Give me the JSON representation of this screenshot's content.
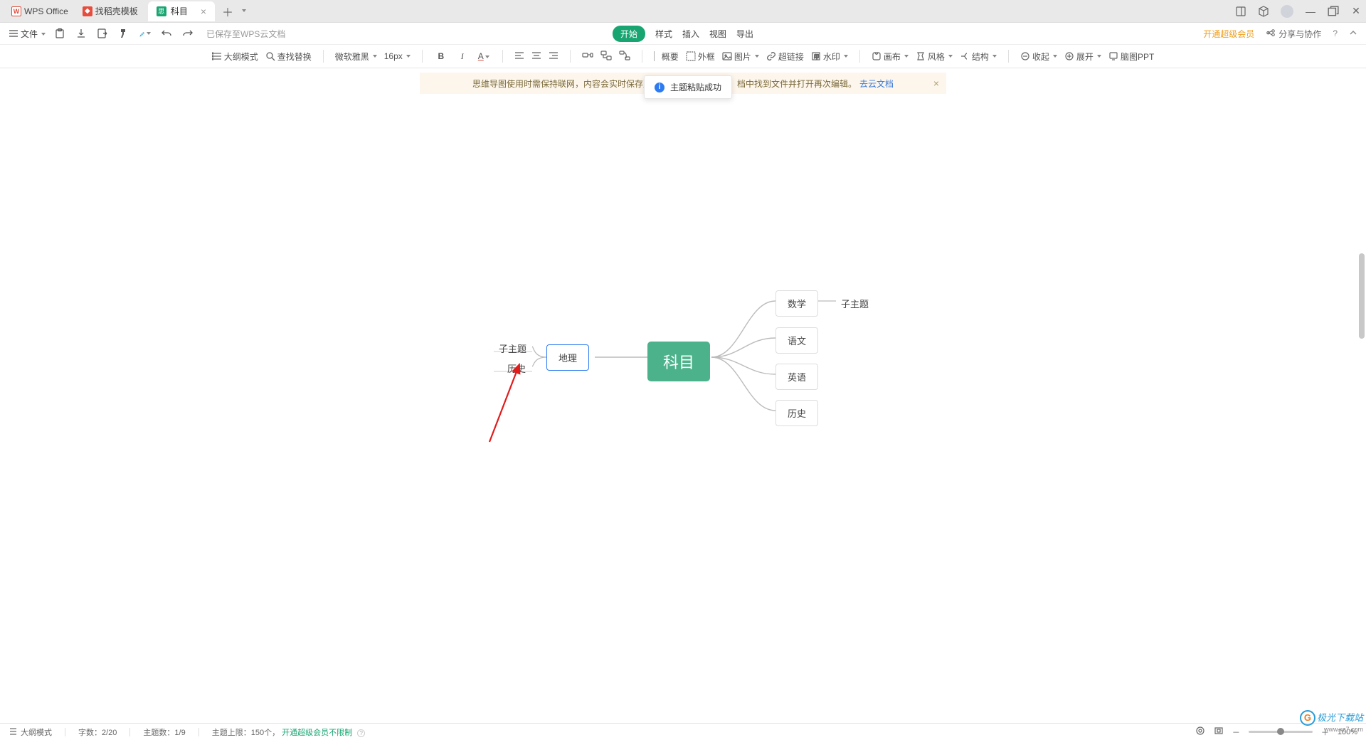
{
  "title_bar": {
    "app_name": "WPS Office",
    "template_tab": "找稻壳模板",
    "doc_tab": "科目"
  },
  "file_bar": {
    "file_btn": "文件",
    "saved_status": "已保存至WPS云文档",
    "menu": {
      "start": "开始",
      "format": "样式",
      "insert": "插入",
      "view": "视图",
      "export": "导出"
    },
    "premium": "开通超级会员",
    "share": "分享与协作"
  },
  "toolbar": {
    "outline": "大纲模式",
    "find": "查找替换",
    "font": "微软雅黑",
    "size": "16px",
    "summary": "概要",
    "frame": "外框",
    "image": "图片",
    "link": "超链接",
    "watermark": "水印",
    "canvas": "画布",
    "style": "风格",
    "structure": "结构",
    "collapse": "收起",
    "expand": "展开",
    "ppt": "脑图PPT"
  },
  "notif": {
    "text_left": "思维导图使用时需保持联网，内容会实时保存至",
    "text_right": "档中找到文件并打开再次编辑。",
    "link": "去云文档"
  },
  "toast": {
    "text": "主题粘贴成功"
  },
  "mindmap": {
    "central": "科目",
    "right": {
      "n1": "数学",
      "n2": "语文",
      "n3": "英语",
      "n4": "历史",
      "sub1": "子主题"
    },
    "left": {
      "n1": "地理",
      "sub1": "子主题",
      "sub2": "历史"
    }
  },
  "status": {
    "outline": "大纲模式",
    "words_label": "字数：",
    "words_val": "2/20",
    "topics_label": "主题数：",
    "topics_val": "1/9",
    "limit_label": "主题上限：",
    "limit_val": "150个，",
    "limit_link": "开通超级会员不限制",
    "zoom": "100%"
  },
  "watermark": {
    "brand": "极光下载站",
    "url": "www.xz7.com"
  }
}
